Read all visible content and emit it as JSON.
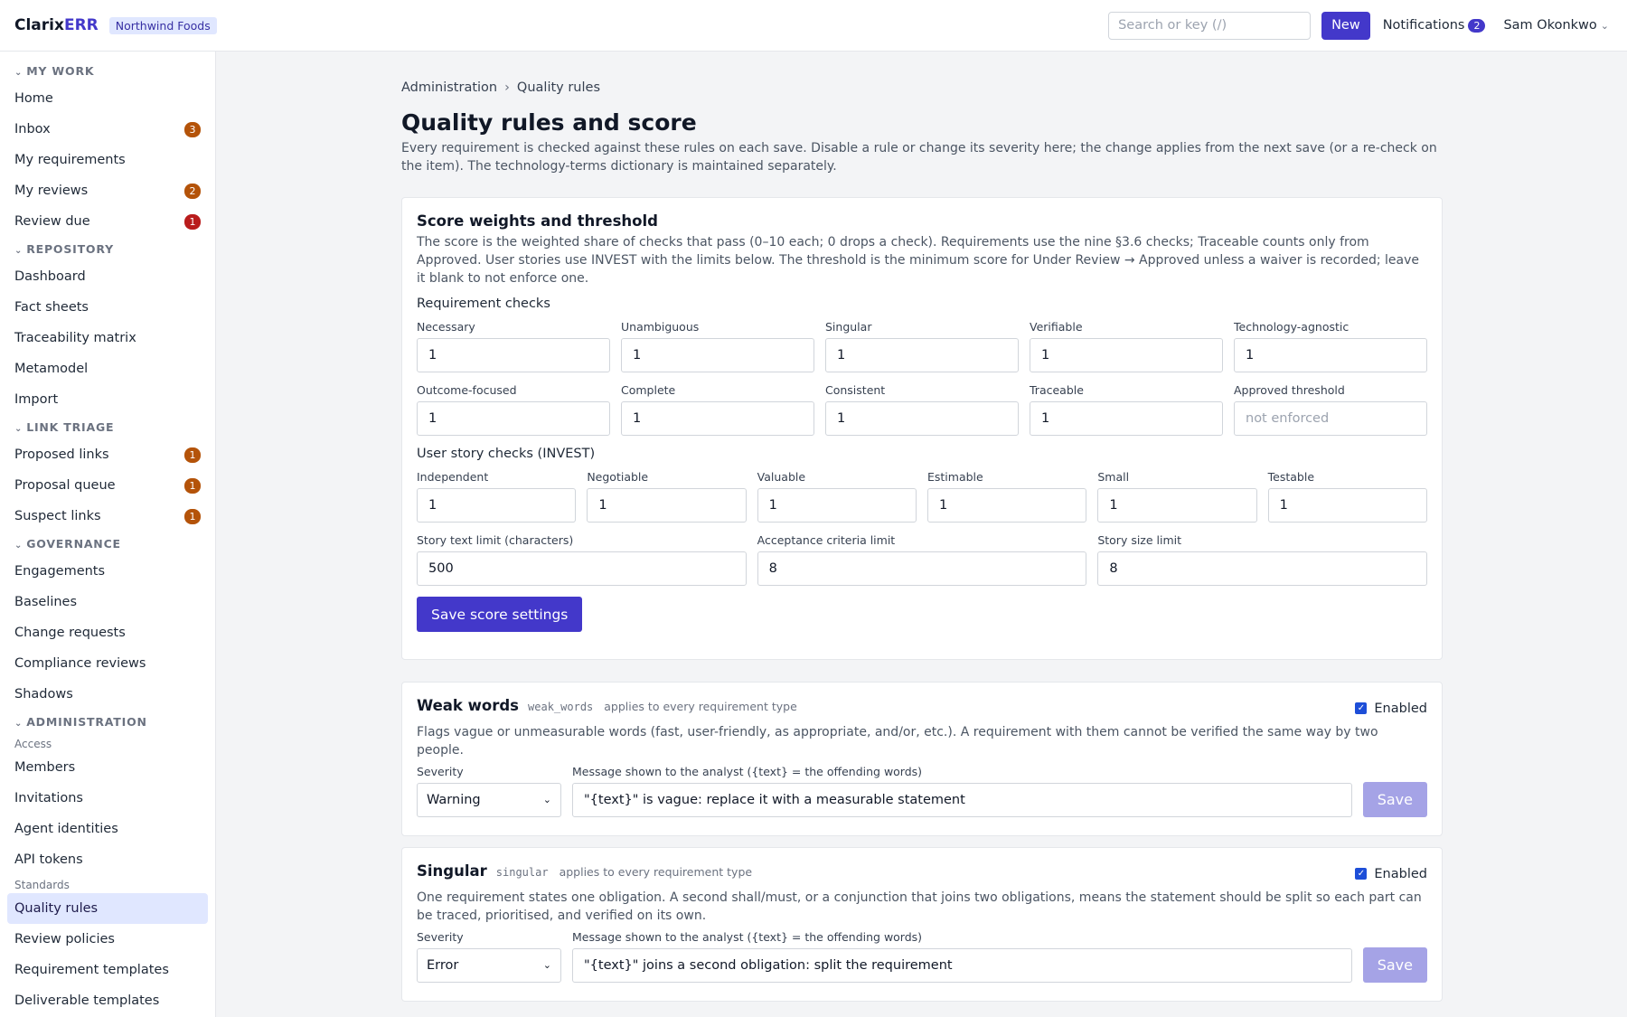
{
  "app": {
    "logo_main": "Clarix",
    "logo_accent": "ERR",
    "org": "Northwind Foods"
  },
  "topbar": {
    "search_placeholder": "Search or key (/)",
    "new_label": "New",
    "notifications_label": "Notifications",
    "notifications_count": "2",
    "user_name": "Sam Okonkwo"
  },
  "sidebar": {
    "my_work": {
      "title": "MY WORK",
      "items": [
        {
          "label": "Home",
          "badge": ""
        },
        {
          "label": "Inbox",
          "badge": "3"
        },
        {
          "label": "My requirements",
          "badge": ""
        },
        {
          "label": "My reviews",
          "badge": "2"
        },
        {
          "label": "Review due",
          "badge": "1"
        }
      ]
    },
    "repository": {
      "title": "REPOSITORY",
      "items": [
        {
          "label": "Dashboard"
        },
        {
          "label": "Fact sheets"
        },
        {
          "label": "Traceability matrix"
        },
        {
          "label": "Metamodel"
        },
        {
          "label": "Import"
        }
      ]
    },
    "link_triage": {
      "title": "LINK TRIAGE",
      "items": [
        {
          "label": "Proposed links",
          "badge": "1"
        },
        {
          "label": "Proposal queue",
          "badge": "1"
        },
        {
          "label": "Suspect links",
          "badge": "1"
        }
      ]
    },
    "governance": {
      "title": "GOVERNANCE",
      "items": [
        {
          "label": "Engagements"
        },
        {
          "label": "Baselines"
        },
        {
          "label": "Change requests"
        },
        {
          "label": "Compliance reviews"
        },
        {
          "label": "Shadows"
        }
      ]
    },
    "administration": {
      "title": "ADMINISTRATION",
      "access_label": "Access",
      "access_items": [
        {
          "label": "Members"
        },
        {
          "label": "Invitations"
        },
        {
          "label": "Agent identities"
        },
        {
          "label": "API tokens"
        }
      ],
      "standards_label": "Standards",
      "standards_items": [
        {
          "label": "Quality rules"
        },
        {
          "label": "Review policies"
        },
        {
          "label": "Requirement templates"
        },
        {
          "label": "Deliverable templates"
        }
      ]
    }
  },
  "breadcrumb": {
    "parent": "Administration",
    "current": "Quality rules"
  },
  "page": {
    "title": "Quality rules and score",
    "description": "Every requirement is checked against these rules on each save. Disable a rule or change its severity here; the change applies from the next save (or a re-check on the item). The technology-terms dictionary is maintained separately."
  },
  "score": {
    "title": "Score weights and threshold",
    "description": "The score is the weighted share of checks that pass (0–10 each; 0 drops a check). Requirements use the nine §3.6 checks; Traceable counts only from Approved. User stories use INVEST with the limits below. The threshold is the minimum score for Under Review → Approved unless a waiver is recorded; leave it blank to not enforce one.",
    "req_label": "Requirement checks",
    "req_fields": [
      {
        "label": "Necessary",
        "value": "1"
      },
      {
        "label": "Unambiguous",
        "value": "1"
      },
      {
        "label": "Singular",
        "value": "1"
      },
      {
        "label": "Verifiable",
        "value": "1"
      },
      {
        "label": "Technology-agnostic",
        "value": "1"
      },
      {
        "label": "Outcome-focused",
        "value": "1"
      },
      {
        "label": "Complete",
        "value": "1"
      },
      {
        "label": "Consistent",
        "value": "1"
      },
      {
        "label": "Traceable",
        "value": "1"
      },
      {
        "label": "Approved threshold",
        "value": "",
        "placeholder": "not enforced"
      }
    ],
    "story_label": "User story checks (INVEST)",
    "story_fields": [
      {
        "label": "Independent",
        "value": "1"
      },
      {
        "label": "Negotiable",
        "value": "1"
      },
      {
        "label": "Valuable",
        "value": "1"
      },
      {
        "label": "Estimable",
        "value": "1"
      },
      {
        "label": "Small",
        "value": "1"
      },
      {
        "label": "Testable",
        "value": "1"
      }
    ],
    "limit_fields": [
      {
        "label": "Story text limit (characters)",
        "value": "500"
      },
      {
        "label": "Acceptance criteria limit",
        "value": "8"
      },
      {
        "label": "Story size limit",
        "value": "8"
      }
    ],
    "save_label": "Save score settings"
  },
  "rules": [
    {
      "name": "Weak words",
      "code": "weak_words",
      "scope": "applies to every requirement type",
      "enabled_label": "Enabled",
      "description": "Flags vague or unmeasurable words (fast, user-friendly, as appropriate, and/or, etc.). A requirement with them cannot be verified the same way by two people.",
      "severity_label": "Severity",
      "severity": "Warning",
      "message_label": "Message shown to the analyst ({text} = the offending words)",
      "message": "\"{text}\" is vague: replace it with a measurable statement",
      "save_label": "Save"
    },
    {
      "name": "Singular",
      "code": "singular",
      "scope": "applies to every requirement type",
      "enabled_label": "Enabled",
      "description": "One requirement states one obligation. A second shall/must, or a conjunction that joins two obligations, means the statement should be split so each part can be traced, prioritised, and verified on its own.",
      "severity_label": "Severity",
      "severity": "Error",
      "message_label": "Message shown to the analyst ({text} = the offending words)",
      "message": "\"{text}\" joins a second obligation: split the requirement",
      "save_label": "Save"
    }
  ],
  "colors": {
    "accent": "#4338ca",
    "badge": "#b45309",
    "badge_alert": "#b91c1c"
  }
}
